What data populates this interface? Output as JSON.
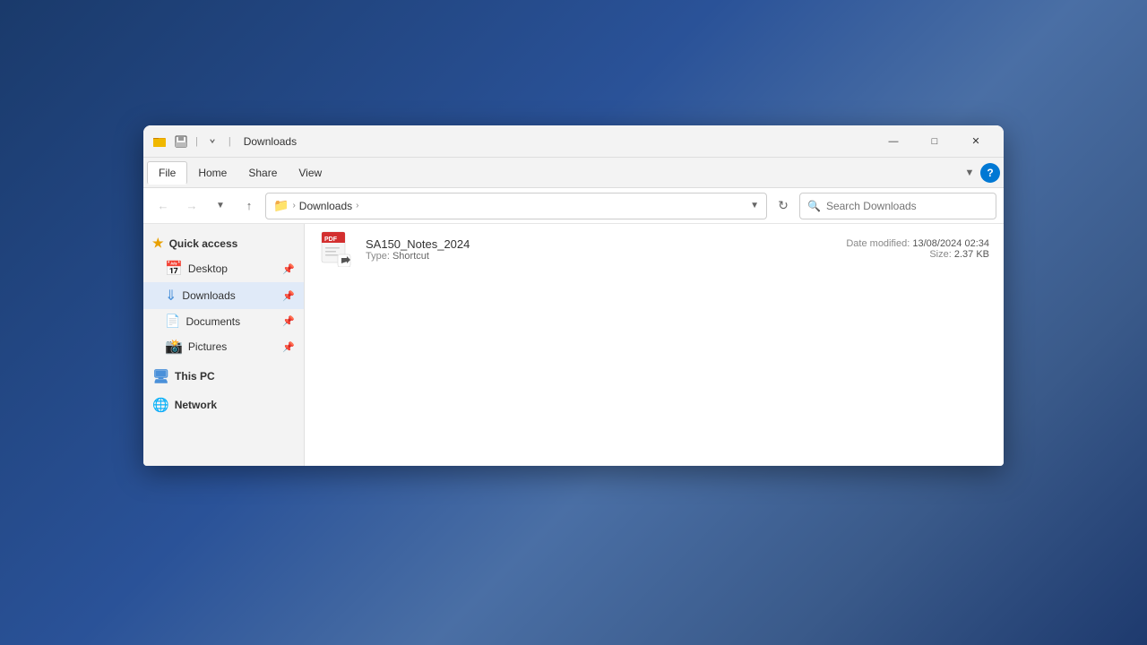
{
  "window": {
    "title": "Downloads",
    "title_bar_icon": "folder",
    "controls": {
      "minimize": "—",
      "maximize": "□",
      "close": "✕"
    }
  },
  "menu": {
    "items": [
      "File",
      "Home",
      "Share",
      "View"
    ],
    "active": "File",
    "help_icon": "?"
  },
  "nav": {
    "back_disabled": true,
    "forward_disabled": true,
    "up": "↑",
    "breadcrumb_icon": "📁",
    "path_items": [
      "Downloads"
    ],
    "search_placeholder": "Search Downloads",
    "refresh": "↻"
  },
  "sidebar": {
    "quick_access": {
      "label": "Quick access",
      "items": [
        {
          "name": "Desktop",
          "icon": "desktop",
          "pinned": true
        },
        {
          "name": "Downloads",
          "icon": "downloads",
          "pinned": true,
          "active": true
        },
        {
          "name": "Documents",
          "icon": "documents",
          "pinned": true
        },
        {
          "name": "Pictures",
          "icon": "pictures",
          "pinned": true
        }
      ]
    },
    "this_pc": {
      "label": "This PC"
    },
    "network": {
      "label": "Network"
    }
  },
  "files": [
    {
      "name": "SA150_Notes_2024",
      "type_label": "Type:",
      "type": "Shortcut",
      "date_modified_label": "Date modified:",
      "date_modified": "13/08/2024 02:34",
      "size_label": "Size:",
      "size": "2.37 KB"
    }
  ]
}
